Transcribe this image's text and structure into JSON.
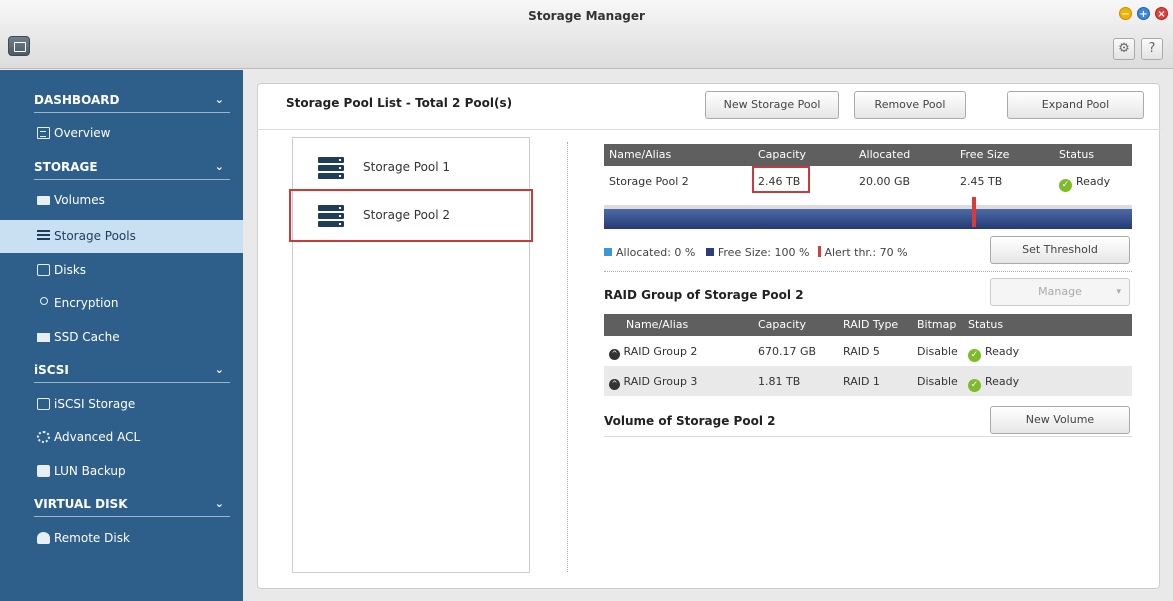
{
  "window": {
    "title": "Storage Manager"
  },
  "sidebar": {
    "sections": [
      {
        "label": "DASHBOARD"
      },
      {
        "label": "STORAGE"
      },
      {
        "label": "iSCSI"
      },
      {
        "label": "VIRTUAL DISK"
      }
    ],
    "items": [
      {
        "label": "Overview",
        "icon": "overview-icon"
      },
      {
        "label": "Volumes",
        "icon": "volume-icon"
      },
      {
        "label": "Storage Pools",
        "icon": "storage-pool-icon",
        "active": true
      },
      {
        "label": "Disks",
        "icon": "disk-icon"
      },
      {
        "label": "Encryption",
        "icon": "key-icon"
      },
      {
        "label": "SSD Cache",
        "icon": "ssd-icon"
      },
      {
        "label": "iSCSI Storage",
        "icon": "iscsi-icon"
      },
      {
        "label": "Advanced ACL",
        "icon": "gear-icon"
      },
      {
        "label": "LUN Backup",
        "icon": "backup-icon"
      },
      {
        "label": "Remote Disk",
        "icon": "remote-disk-icon"
      }
    ]
  },
  "pool_list": {
    "title": "Storage Pool List - Total 2 Pool(s)",
    "buttons": {
      "new": "New Storage Pool",
      "remove": "Remove Pool",
      "expand": "Expand Pool"
    },
    "pools": [
      {
        "label": "Storage Pool 1"
      },
      {
        "label": "Storage Pool 2",
        "selected": true
      }
    ]
  },
  "pool_detail": {
    "headers": [
      "Name/Alias",
      "Capacity",
      "Allocated",
      "Free Size",
      "Status"
    ],
    "row": {
      "name": "Storage Pool 2",
      "capacity": "2.46 TB",
      "allocated": "20.00 GB",
      "free": "2.45 TB",
      "status": "Ready"
    },
    "usage": {
      "allocated_fraction": 0.0,
      "alert_threshold_fraction": 0.7
    },
    "legend": {
      "allocated": "Allocated: 0 %",
      "free": "Free Size: 100 %",
      "alert": "Alert thr.: 70 %"
    },
    "set_threshold": "Set Threshold"
  },
  "raid": {
    "title": "RAID Group of Storage Pool 2",
    "manage": "Manage",
    "headers": [
      "Name/Alias",
      "Capacity",
      "RAID Type",
      "Bitmap",
      "Status"
    ],
    "rows": [
      {
        "name": "RAID Group 2",
        "capacity": "670.17 GB",
        "type": "RAID 5",
        "bitmap": "Disable",
        "status": "Ready"
      },
      {
        "name": "RAID Group 3",
        "capacity": "1.81 TB",
        "type": "RAID 1",
        "bitmap": "Disable",
        "status": "Ready"
      }
    ]
  },
  "volume": {
    "title": "Volume of Storage Pool 2",
    "new_volume": "New Volume"
  },
  "colors": {
    "sidebar": "#2e5f8a",
    "active_item": "#c9e0f3",
    "highlight": "#c93a3a",
    "alert": "#d93a3a"
  }
}
